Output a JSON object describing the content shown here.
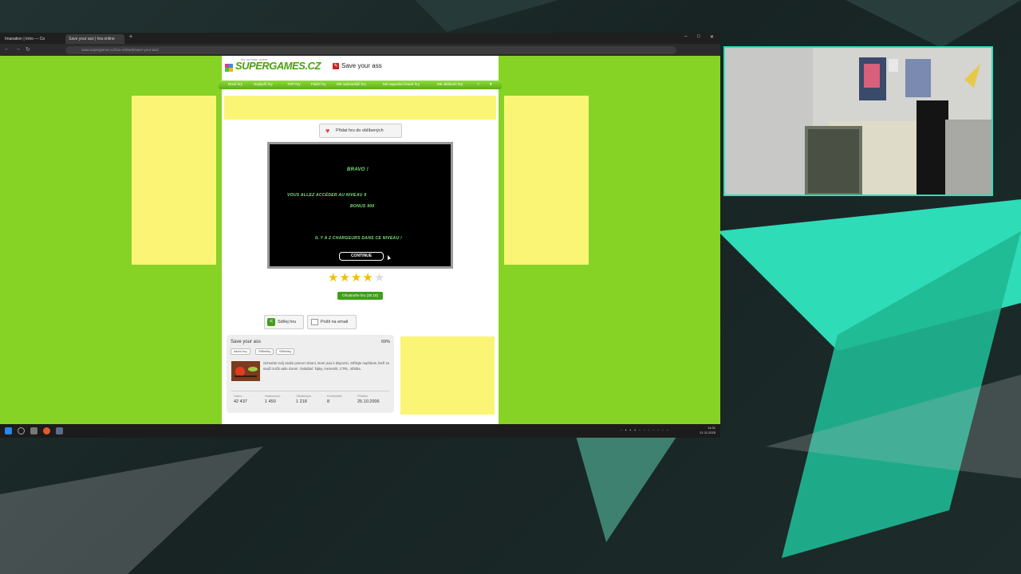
{
  "browser": {
    "tabs": [
      {
        "label": "Imanation | Intro — Co"
      },
      {
        "label": "Save your ass | hra online"
      }
    ],
    "new_tab_glyph": "+",
    "url": "www.supergames.cz/hra-online/5/save-your-ass/"
  },
  "site": {
    "logo_text": "SUPERGAMES.CZ",
    "logo_tagline": "hry na hraní online",
    "game_title": "Save your ass",
    "nav": [
      "Nové hry",
      "Nejlepší hry",
      "TOP hry",
      "Flash hry",
      "Mé nejhranější hry",
      "Mé naposled hrané hry",
      "Mé oblíbené hry",
      "?"
    ],
    "nav_arrow": "▼",
    "fav_button": "Přidat hru do oblíbených"
  },
  "game_screen": {
    "bravo": "BRAVO !",
    "level_line": "VOUS ALLEZ ACCÉDER AU NIVEAU 9",
    "bonus_line": "BONUS 900",
    "chargers_line": "IL Y A 2 CHARGEURS DANS CE NIVEAU !",
    "continue": "CONTINUE"
  },
  "rating": {
    "value": 3.5,
    "max": 5,
    "button": "Ohodnoťte hru (30 10)"
  },
  "share": {
    "share_button": "Sdílej hru",
    "email_button": "Pošli na email"
  },
  "info": {
    "title": "Save your ass",
    "percent": "69%",
    "tags": [
      "Akční hry",
      "Střílečky",
      "Střílečky"
    ],
    "description": "Ochraňte svůj zadek pomocí zbraní, které jsou k dispozici. Střílejte nepřátele, kteří se snaží zničit vaše území. Ovládání: šipky, mezerník, CTRL, střelba.",
    "stats": [
      {
        "label": "Hráno",
        "value": "42 437"
      },
      {
        "label": "Hodnoceno",
        "value": "1 450"
      },
      {
        "label": "Oblíbených",
        "value": "1 218"
      },
      {
        "label": "Komentářů",
        "value": "8"
      },
      {
        "label": "Přidáno",
        "value": "25.10.2006"
      }
    ]
  },
  "taskbar": {
    "clock_time": "14:31",
    "clock_date": "21.11.2025"
  },
  "colors": {
    "page_green": "#86d326",
    "ad_yellow": "#fbf576",
    "game_text": "#7ee07a",
    "cam_border": "#2ee0b8"
  }
}
